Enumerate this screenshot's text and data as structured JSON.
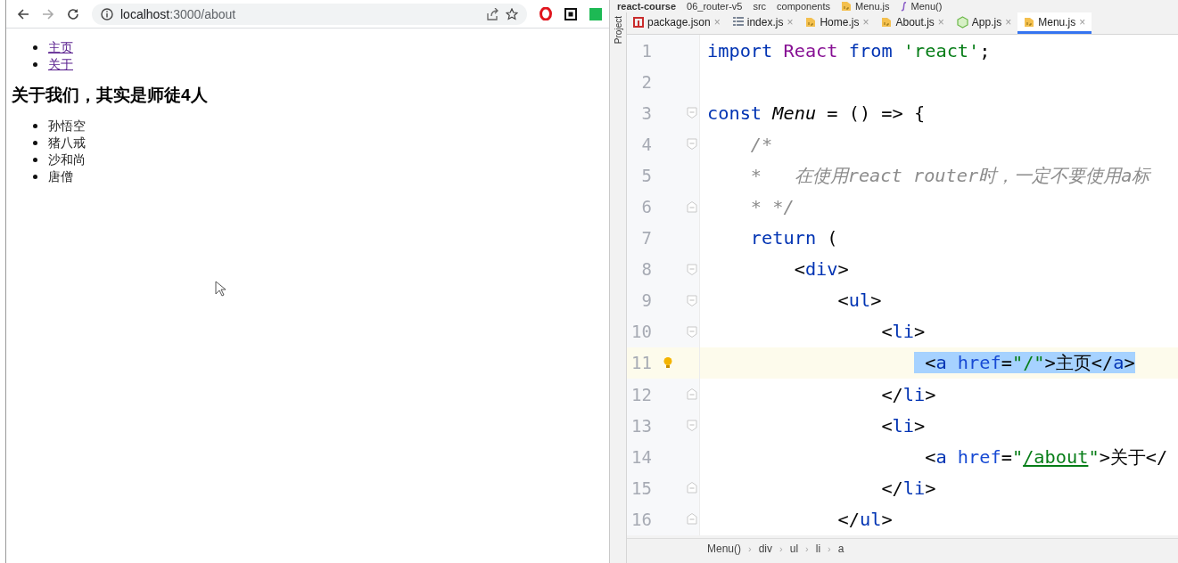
{
  "browser": {
    "url": {
      "host": "localhost",
      "path": ":3000/about"
    },
    "nav_links": [
      {
        "label": "主页"
      },
      {
        "label": "关于"
      }
    ],
    "heading": "关于我们，其实是师徒4人",
    "members": [
      "孙悟空",
      "猪八戒",
      "沙和尚",
      "唐僧"
    ]
  },
  "ide": {
    "breadcrumb": [
      {
        "label": "react-course",
        "kind": "project"
      },
      {
        "label": "06_router-v5",
        "kind": "folder"
      },
      {
        "label": "src",
        "kind": "folder"
      },
      {
        "label": "components",
        "kind": "folder"
      },
      {
        "label": "Menu.js",
        "kind": "js"
      },
      {
        "label": "Menu()",
        "kind": "function"
      }
    ],
    "sidebar_label": "Project",
    "tabs": [
      {
        "label": "package.json",
        "kind": "npm",
        "close": "×",
        "selected": false
      },
      {
        "label": "index.js",
        "kind": "text",
        "close": "×",
        "selected": false
      },
      {
        "label": "Home.js",
        "kind": "js",
        "close": "×",
        "selected": false
      },
      {
        "label": "About.js",
        "kind": "js",
        "close": "×",
        "selected": false
      },
      {
        "label": "App.js",
        "kind": "node",
        "close": "×",
        "selected": false
      },
      {
        "label": "Menu.js",
        "kind": "js",
        "close": "×",
        "selected": true
      }
    ],
    "lines": [
      {
        "number": "1",
        "current": false,
        "fold_start": false,
        "fold_end": false,
        "tokens": [
          {
            "kind": "keyword",
            "text": "import ",
            "selected": false
          },
          {
            "kind": "class",
            "text": "React ",
            "selected": false
          },
          {
            "kind": "keyword",
            "text": "from ",
            "selected": false
          },
          {
            "kind": "string",
            "text": "'react'",
            "selected": false
          },
          {
            "kind": "plain",
            "text": ";",
            "selected": false
          }
        ]
      },
      {
        "number": "2",
        "current": false,
        "fold_start": false,
        "fold_end": false
      },
      {
        "number": "3",
        "current": false,
        "fold_start": true,
        "fold_end": false,
        "tokens": [
          {
            "kind": "keyword",
            "text": "const ",
            "selected": false
          },
          {
            "kind": "function",
            "text": "Menu",
            "selected": false
          },
          {
            "kind": "plain",
            "text": " = () => {",
            "selected": false
          }
        ]
      },
      {
        "number": "4",
        "current": false,
        "fold_start": true,
        "fold_end": false,
        "tokens": [
          {
            "kind": "comment",
            "text": "    /*",
            "selected": false
          }
        ]
      },
      {
        "number": "5",
        "current": false,
        "fold_start": false,
        "fold_end": false,
        "tokens": [
          {
            "kind": "comment",
            "text": "    *   在使用react router时，一定不要使用a标",
            "selected": false
          }
        ]
      },
      {
        "number": "6",
        "current": false,
        "fold_start": false,
        "fold_end": true,
        "tokens": [
          {
            "kind": "comment",
            "text": "    * */",
            "selected": false
          }
        ]
      },
      {
        "number": "7",
        "current": false,
        "fold_start": false,
        "fold_end": false,
        "tokens": [
          {
            "kind": "keyword",
            "text": "    return",
            "selected": false
          },
          {
            "kind": "plain",
            "text": " (",
            "selected": false
          }
        ]
      },
      {
        "number": "8",
        "current": false,
        "fold_start": true,
        "fold_end": false,
        "tokens": [
          {
            "kind": "plain",
            "text": "        <",
            "selected": false
          },
          {
            "kind": "tag",
            "text": "div",
            "selected": false
          },
          {
            "kind": "plain",
            "text": ">",
            "selected": false
          }
        ]
      },
      {
        "number": "9",
        "current": false,
        "fold_start": true,
        "fold_end": false,
        "tokens": [
          {
            "kind": "plain",
            "text": "            <",
            "selected": false
          },
          {
            "kind": "tag",
            "text": "ul",
            "selected": false
          },
          {
            "kind": "plain",
            "text": ">",
            "selected": false
          }
        ]
      },
      {
        "number": "10",
        "current": false,
        "fold_start": true,
        "fold_end": false,
        "tokens": [
          {
            "kind": "plain",
            "text": "                <",
            "selected": false
          },
          {
            "kind": "tag",
            "text": "li",
            "selected": false
          },
          {
            "kind": "plain",
            "text": ">",
            "selected": false
          }
        ]
      },
      {
        "number": "11",
        "current": true,
        "fold_start": false,
        "fold_end": false,
        "tokens": [
          {
            "kind": "plain",
            "text": "                    <",
            "selected": true
          },
          {
            "kind": "tag",
            "text": "a ",
            "selected": true
          },
          {
            "kind": "attr",
            "text": "href",
            "selected": true
          },
          {
            "kind": "plain",
            "text": "=",
            "selected": true
          },
          {
            "kind": "string",
            "text": "\"/\"",
            "selected": true
          },
          {
            "kind": "plain",
            "text": ">主页</",
            "selected": true
          },
          {
            "kind": "tag",
            "text": "a",
            "selected": true
          },
          {
            "kind": "plain",
            "text": ">",
            "selected": true
          }
        ]
      },
      {
        "number": "12",
        "current": false,
        "fold_start": false,
        "fold_end": true,
        "tokens": [
          {
            "kind": "plain",
            "text": "                </",
            "selected": false
          },
          {
            "kind": "tag",
            "text": "li",
            "selected": false
          },
          {
            "kind": "plain",
            "text": ">",
            "selected": false
          }
        ]
      },
      {
        "number": "13",
        "current": false,
        "fold_start": true,
        "fold_end": false,
        "tokens": [
          {
            "kind": "plain",
            "text": "                <",
            "selected": false
          },
          {
            "kind": "tag",
            "text": "li",
            "selected": false
          },
          {
            "kind": "plain",
            "text": ">",
            "selected": false
          }
        ]
      },
      {
        "number": "14",
        "current": false,
        "fold_start": false,
        "fold_end": false,
        "tokens": [
          {
            "kind": "plain",
            "text": "                    <",
            "selected": false
          },
          {
            "kind": "tag",
            "text": "a ",
            "selected": false
          },
          {
            "kind": "attr",
            "text": "href",
            "selected": false
          },
          {
            "kind": "plain",
            "text": "=",
            "selected": false
          },
          {
            "kind": "string",
            "text": "\"",
            "selected": false
          },
          {
            "kind": "link",
            "text": "/about",
            "selected": false
          },
          {
            "kind": "string",
            "text": "\"",
            "selected": false
          },
          {
            "kind": "plain",
            "text": ">关于</",
            "selected": false
          }
        ]
      },
      {
        "number": "15",
        "current": false,
        "fold_start": false,
        "fold_end": true,
        "tokens": [
          {
            "kind": "plain",
            "text": "                </",
            "selected": false
          },
          {
            "kind": "tag",
            "text": "li",
            "selected": false
          },
          {
            "kind": "plain",
            "text": ">",
            "selected": false
          }
        ]
      },
      {
        "number": "16",
        "current": false,
        "fold_start": false,
        "fold_end": true,
        "tokens": [
          {
            "kind": "plain",
            "text": "            </",
            "selected": false
          },
          {
            "kind": "tag",
            "text": "ul",
            "selected": false
          },
          {
            "kind": "plain",
            "text": ">",
            "selected": false
          }
        ]
      }
    ],
    "status_path": [
      {
        "label": "Menu()"
      },
      {
        "separator": "›",
        "label": "div"
      },
      {
        "separator": "›",
        "label": "ul"
      },
      {
        "separator": "›",
        "label": "li"
      },
      {
        "separator": "›",
        "label": "a"
      }
    ]
  }
}
